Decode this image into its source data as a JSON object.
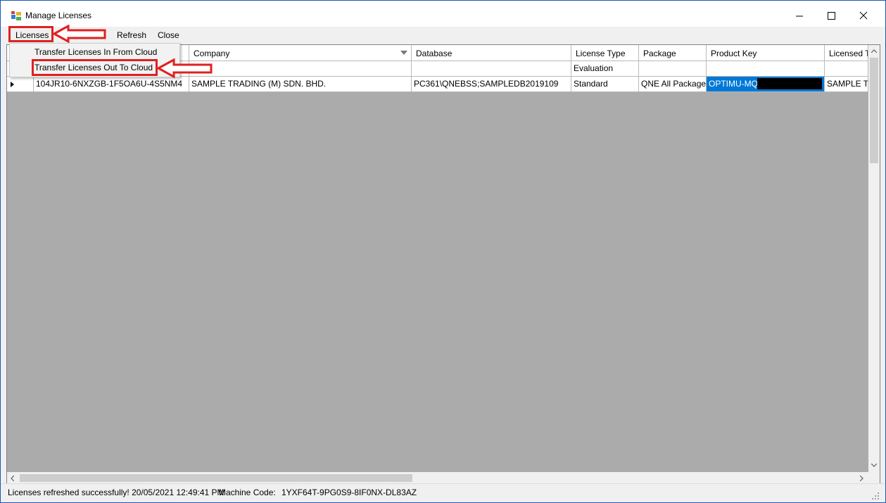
{
  "window": {
    "title": "Manage Licenses",
    "controls": {
      "minimize": "–",
      "maximize": "□",
      "close": "✕"
    }
  },
  "menu": {
    "licenses": "Licenses",
    "refresh": "Refresh",
    "close": "Close"
  },
  "dropdown": {
    "items": [
      "Transfer Licenses In From Cloud",
      "Transfer Licenses Out To Cloud"
    ]
  },
  "grid": {
    "columns": [
      "Company",
      "Database",
      "License Type",
      "Package",
      "Product Key",
      "Licensed T"
    ],
    "filter_row": {
      "license_type": "Evaluation"
    },
    "rows": [
      {
        "license_no": "104JR10-6NXZGB-1F5OA6U-4S5NM4",
        "company": "SAMPLE TRADING (M) SDN. BHD.",
        "database": "PC361\\QNEBSS;SAMPLEDB2019109",
        "license_type": "Standard",
        "package": "QNE All Packages",
        "product_key": "OPTIMU-MQN",
        "licensed_to": "SAMPLE TF"
      }
    ]
  },
  "status": {
    "message": "Licenses refreshed successfully! 20/05/2021 12:49:41 PM",
    "machine_code_label": "Machine Code:",
    "machine_code": "1YXF64T-9PG0S9-8IF0NX-DL83AZ"
  },
  "colors": {
    "selection": "#0078d7",
    "highlight": "#e02020",
    "grid_background": "#ababab",
    "desktop": "#1a56b8"
  },
  "icons": [
    "app-icon",
    "dropdown-arrow-icon",
    "row-indicator-icon",
    "scroll-up-icon",
    "scroll-down-icon",
    "scroll-left-icon",
    "scroll-right-icon",
    "resize-grip-icon"
  ]
}
